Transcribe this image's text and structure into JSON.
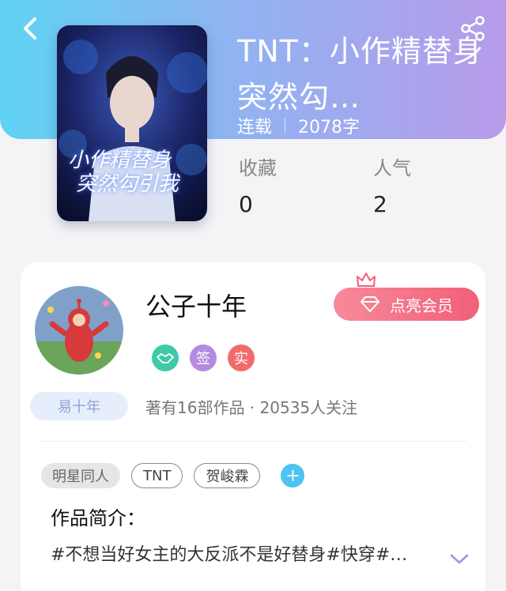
{
  "book": {
    "title": "TNT：小作精替身突然勾…",
    "status": "连载",
    "word_count": "2078字",
    "cover_title_line1": "小作精替身",
    "cover_title_line2": "突然勾引我"
  },
  "stats": {
    "favorites_label": "收藏",
    "favorites_value": "0",
    "popularity_label": "人气",
    "popularity_value": "2"
  },
  "author": {
    "name": "公子十年",
    "badges": [
      {
        "icon": "handshake-icon",
        "color": "#3ec9a7"
      },
      {
        "text": "签",
        "color": "#b58be0"
      },
      {
        "text": "实",
        "color": "#f26b6b"
      }
    ],
    "level_badge": "易十年",
    "works_followers": "著有16部作品 · 20535人关注",
    "vip_button": "点亮会员"
  },
  "tags": [
    "明星同人",
    "TNT",
    "贺峻霖"
  ],
  "intro": {
    "title": "作品简介：",
    "text": "#不想当好女主的大反派不是好替身#快穿#…"
  },
  "colors": {
    "header_start": "#5fd3f3",
    "header_end": "#b79be9",
    "vip": "#f25f78",
    "add_tag": "#4cc3f2"
  }
}
